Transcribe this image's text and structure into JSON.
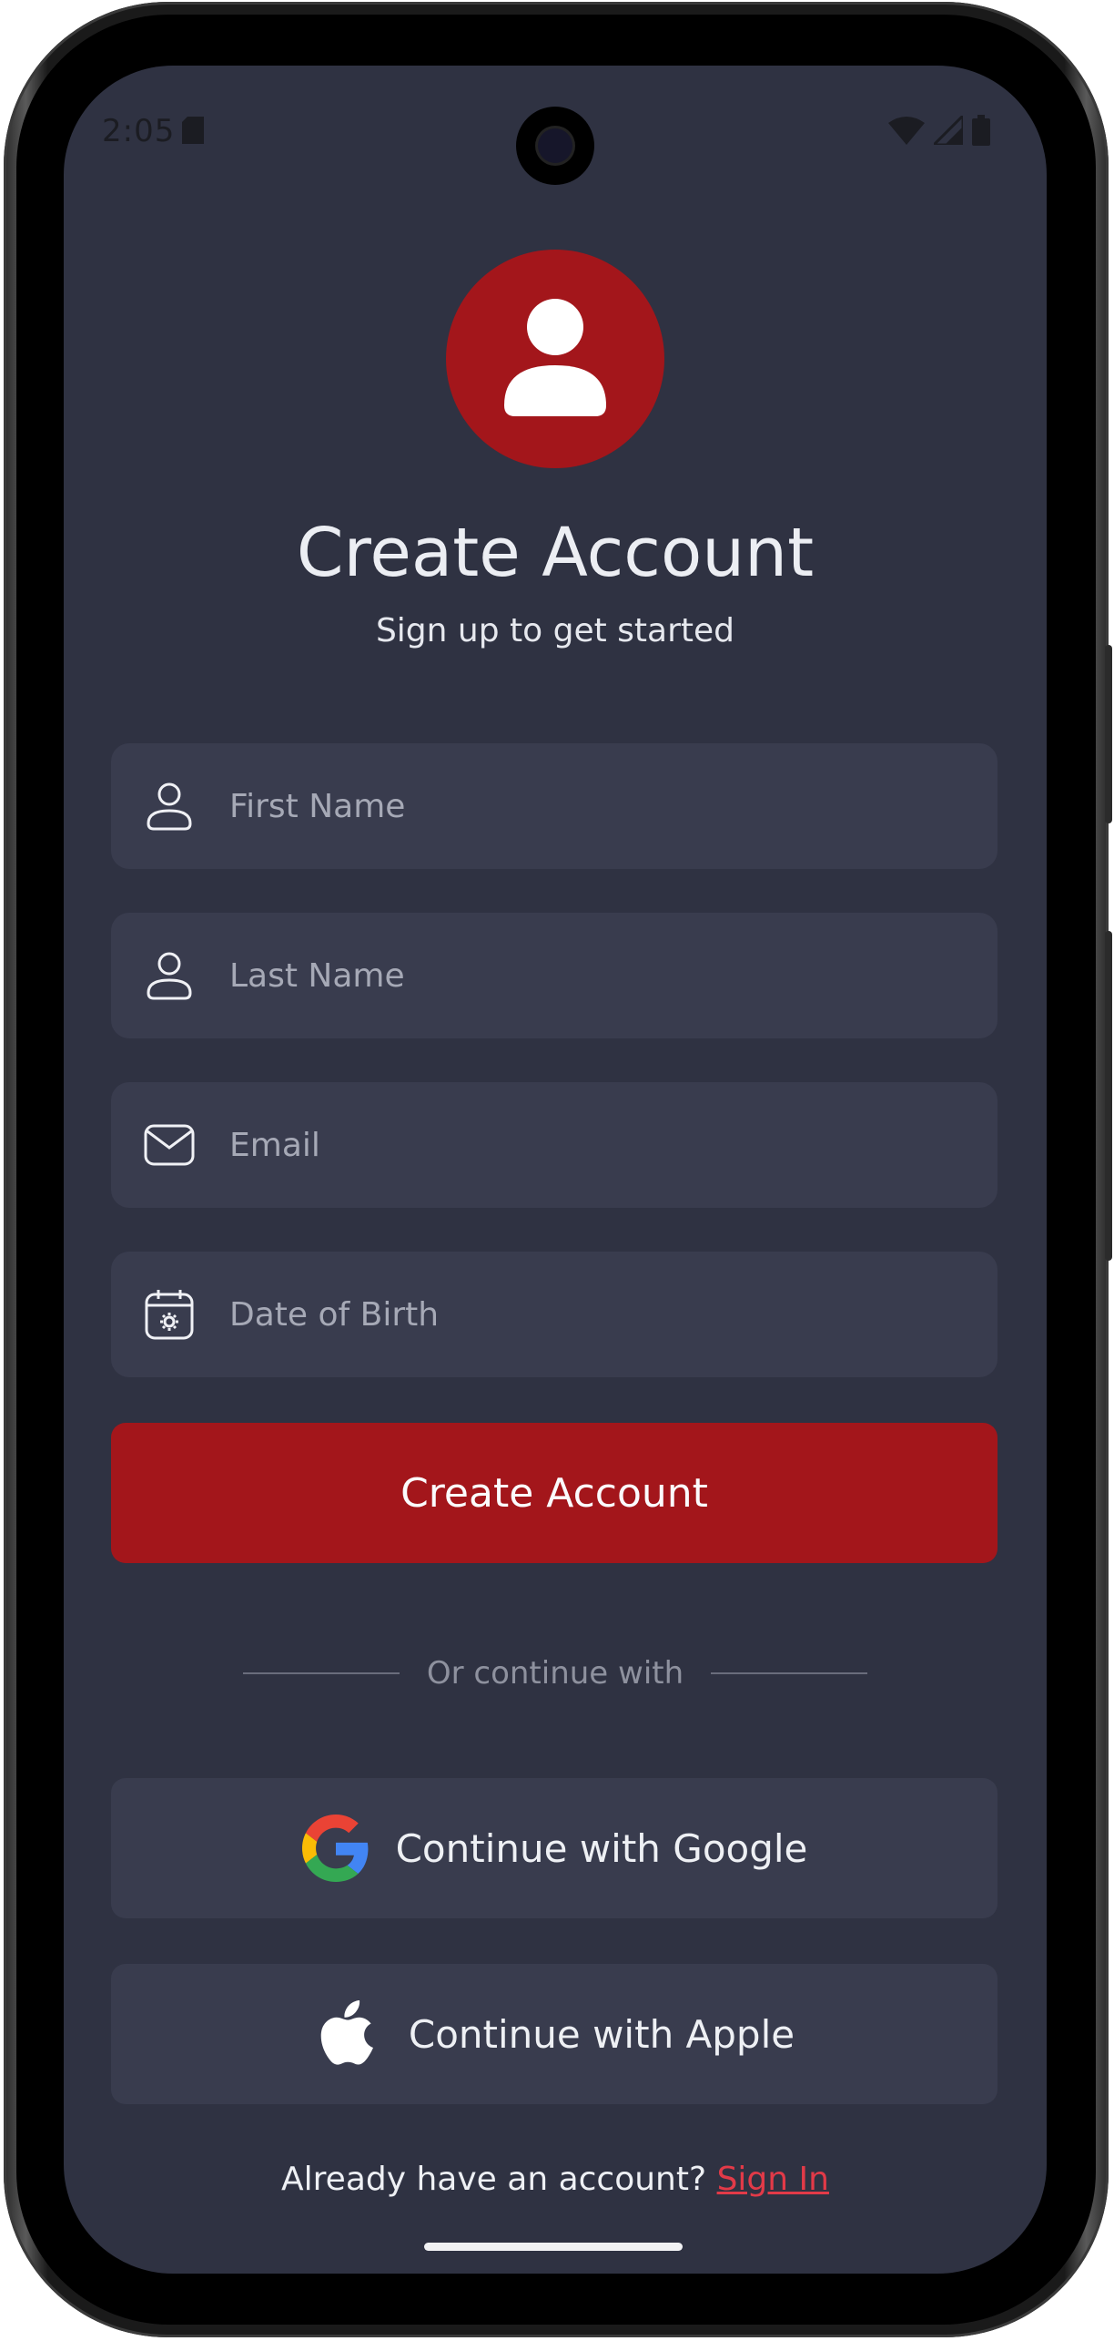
{
  "status_bar": {
    "time": "2:05",
    "icons": [
      "sd-card-icon",
      "wifi-icon",
      "cellular-signal-icon",
      "battery-icon"
    ]
  },
  "header": {
    "avatar_icon": "user-icon",
    "title": "Create Account",
    "subtitle": "Sign up to get started"
  },
  "form": {
    "fields": [
      {
        "icon": "user-icon",
        "placeholder": "First Name",
        "value": ""
      },
      {
        "icon": "user-icon",
        "placeholder": "Last Name",
        "value": ""
      },
      {
        "icon": "mail-icon",
        "placeholder": "Email",
        "value": ""
      },
      {
        "icon": "calendar-settings-icon",
        "placeholder": "Date of Birth",
        "value": ""
      }
    ],
    "submit_label": "Create Account"
  },
  "divider_text": "Or continue with",
  "social": {
    "google_label": "Continue with Google",
    "apple_label": "Continue with Apple"
  },
  "footer": {
    "prompt": "Already have an account?",
    "link": "Sign In"
  },
  "colors": {
    "background": "#2f3242",
    "field": "#393c4e",
    "accent": "#a3161b",
    "link": "#e23a48",
    "text": "#eceef3",
    "placeholder": "#a6a9b6"
  }
}
